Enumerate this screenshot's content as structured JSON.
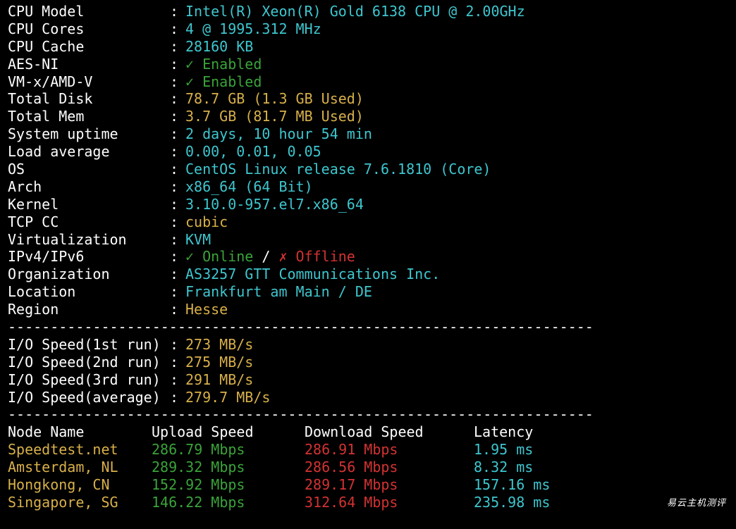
{
  "sysinfo": [
    {
      "label": "CPU Model",
      "value": "Intel(R) Xeon(R) Gold 6138 CPU @ 2.00GHz",
      "color": "cyan"
    },
    {
      "label": "CPU Cores",
      "value": "4 @ 1995.312 MHz",
      "color": "cyan"
    },
    {
      "label": "CPU Cache",
      "value": "28160 KB",
      "color": "cyan"
    },
    {
      "label": "AES-NI",
      "value": "✓ Enabled",
      "color": "green"
    },
    {
      "label": "VM-x/AMD-V",
      "value": "✓ Enabled",
      "color": "green"
    },
    {
      "label": "Total Disk",
      "value": "78.7 GB (1.3 GB Used)",
      "color": "yellow"
    },
    {
      "label": "Total Mem",
      "value": "3.7 GB (81.7 MB Used)",
      "color": "yellow"
    },
    {
      "label": "System uptime",
      "value": "2 days, 10 hour 54 min",
      "color": "cyan"
    },
    {
      "label": "Load average",
      "value": "0.00, 0.01, 0.05",
      "color": "cyan"
    },
    {
      "label": "OS",
      "value": "CentOS Linux release 7.6.1810 (Core)",
      "color": "cyan"
    },
    {
      "label": "Arch",
      "value": "x86_64 (64 Bit)",
      "color": "cyan"
    },
    {
      "label": "Kernel",
      "value": "3.10.0-957.el7.x86_64",
      "color": "cyan"
    },
    {
      "label": "TCP CC",
      "value": "cubic",
      "color": "yellow"
    },
    {
      "label": "Virtualization",
      "value": "KVM",
      "color": "cyan"
    }
  ],
  "ipv": {
    "label": "IPv4/IPv6",
    "online": "✓ Online",
    "slash": " / ",
    "offline": "✗ Offline"
  },
  "location": [
    {
      "label": "Organization",
      "value": "AS3257 GTT Communications Inc.",
      "color": "cyan"
    },
    {
      "label": "Location",
      "value": "Frankfurt am Main / DE",
      "color": "cyan"
    },
    {
      "label": "Region",
      "value": "Hesse",
      "color": "yellow"
    }
  ],
  "separator": ":",
  "divider": "----------------------------------------------------------------------",
  "io": [
    {
      "label": "I/O Speed(1st run)",
      "value": "273 MB/s"
    },
    {
      "label": "I/O Speed(2nd run)",
      "value": "275 MB/s"
    },
    {
      "label": "I/O Speed(3rd run)",
      "value": "291 MB/s"
    },
    {
      "label": "I/O Speed(average)",
      "value": "279.7 MB/s"
    }
  ],
  "speed_headers": {
    "node": "Node Name",
    "upload": "Upload Speed",
    "download": "Download Speed",
    "latency": "Latency"
  },
  "speed_rows": [
    {
      "node": "Speedtest.net",
      "upload": "286.79 Mbps",
      "download": "286.91 Mbps",
      "latency": "1.95 ms"
    },
    {
      "node": "Amsterdam, NL",
      "upload": "289.32 Mbps",
      "download": "286.56 Mbps",
      "latency": "8.32 ms"
    },
    {
      "node": "Hongkong, CN",
      "upload": "152.92 Mbps",
      "download": "289.17 Mbps",
      "latency": "157.16 ms"
    },
    {
      "node": "Singapore, SG",
      "upload": "146.22 Mbps",
      "download": "312.64 Mbps",
      "latency": "235.98 ms"
    }
  ],
  "watermark": "易云主机测评",
  "colors": {
    "cyan": "#3ec6cf",
    "yellow": "#d8b04a",
    "green": "#3aa33a",
    "red": "#d33232",
    "background": "#000000"
  }
}
